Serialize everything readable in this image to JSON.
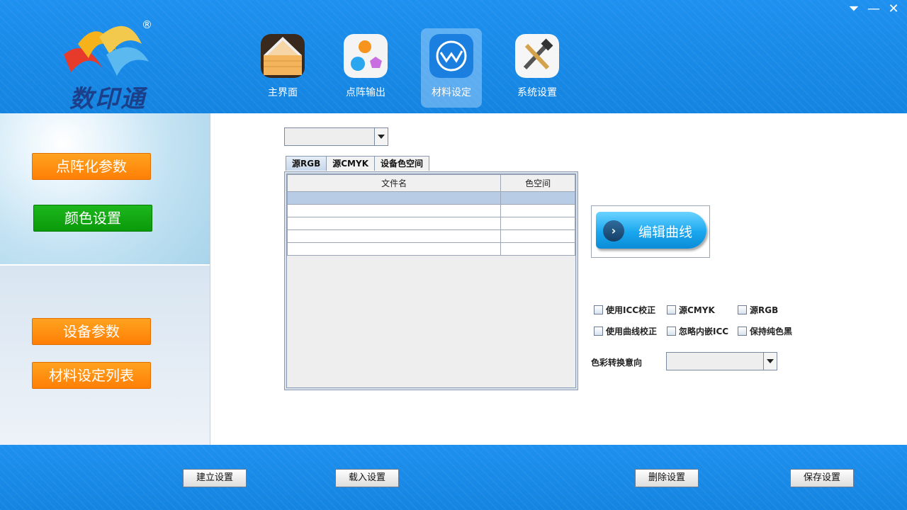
{
  "app": {
    "logo_text": "数印通",
    "registered_mark": "®"
  },
  "window_controls": {
    "menu": "⏷",
    "minimize": "—",
    "close": "✕"
  },
  "nav": {
    "items": [
      {
        "label": "主界面",
        "icon": "home-icon"
      },
      {
        "label": "点阵输出",
        "icon": "dots-icon"
      },
      {
        "label": "材料设定",
        "icon": "material-icon",
        "active": true
      },
      {
        "label": "系统设置",
        "icon": "tools-icon"
      }
    ]
  },
  "sidebar": {
    "items": [
      {
        "label": "点阵化参数",
        "color": "#ff8c0e"
      },
      {
        "label": "颜色设置",
        "color": "#12a812",
        "active": true
      },
      {
        "label": "设备参数",
        "color": "#ff8c0e"
      },
      {
        "label": "材料设定列表",
        "color": "#ff8c0e"
      }
    ]
  },
  "main": {
    "top_combo_value": "",
    "tabs": [
      {
        "label": "源RGB",
        "active": true
      },
      {
        "label": "源CMYK"
      },
      {
        "label": "设备色空间"
      }
    ],
    "table": {
      "columns": [
        "文件名",
        "色空间"
      ],
      "rows": [
        [
          "",
          ""
        ],
        [
          "",
          ""
        ],
        [
          "",
          ""
        ],
        [
          "",
          ""
        ],
        [
          "",
          ""
        ]
      ]
    },
    "edit_curve_label": "编辑曲线",
    "checkboxes": [
      {
        "label": "使用ICC校正",
        "checked": false
      },
      {
        "label": "源CMYK",
        "checked": false
      },
      {
        "label": "源RGB",
        "checked": false
      },
      {
        "label": "使用曲线校正",
        "checked": false
      },
      {
        "label": "忽略内嵌ICC",
        "checked": false
      },
      {
        "label": "保持纯色黑",
        "checked": false
      }
    ],
    "intent_label": "色彩转换意向",
    "intent_value": ""
  },
  "footer": {
    "create": "建立设置",
    "load": "载入设置",
    "delete": "删除设置",
    "save": "保存设置"
  },
  "colors": {
    "header_blue": "#1a8ae6",
    "orange": "#ff8c0e",
    "green": "#12a812",
    "selected_row": "#b8cce6"
  }
}
